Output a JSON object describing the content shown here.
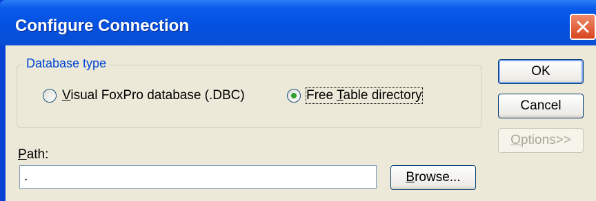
{
  "window": {
    "title": "Configure Connection",
    "close_icon": "close-icon"
  },
  "group": {
    "label": "Database type"
  },
  "options": [
    {
      "label_before": "",
      "mnemonic": "V",
      "label_after": "isual FoxPro database (.DBC)",
      "checked": false
    },
    {
      "label_before": "Free ",
      "mnemonic": "T",
      "label_after": "able directory",
      "checked": true
    }
  ],
  "buttons": {
    "ok": "OK",
    "cancel": "Cancel",
    "options_mnemonic": "O",
    "options_rest": "ptions>>",
    "browse_mnemonic": "B",
    "browse_rest": "rowse..."
  },
  "path": {
    "label_mnemonic": "P",
    "label_rest": "ath:",
    "value": "."
  },
  "colors": {
    "title_blue": "#0550e0",
    "dialog_bg": "#ece9d8",
    "group_label": "#0046d5",
    "radio_dot": "#2fa02f"
  }
}
